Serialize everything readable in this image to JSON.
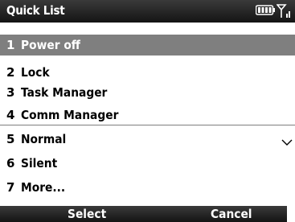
{
  "title": "Quick List",
  "items": [
    {
      "num": "1",
      "label": "Power off"
    },
    {
      "num": "2",
      "label": "Lock"
    },
    {
      "num": "3",
      "label": "Task Manager"
    },
    {
      "num": "4",
      "label": "Comm Manager"
    },
    {
      "num": "5",
      "label": "Normal"
    },
    {
      "num": "6",
      "label": "Silent"
    },
    {
      "num": "7",
      "label": "More..."
    }
  ],
  "selected_item": "Power off",
  "softkeys": {
    "left": "Select",
    "right": "Cancel"
  },
  "icons": {
    "battery": "battery-icon",
    "signal": "signal-strength-icon",
    "expand": "chevron-down-icon"
  },
  "colors": {
    "titlebar": "#1e1e1e",
    "selection": "#7f7f7f",
    "background": "#ffffff"
  }
}
